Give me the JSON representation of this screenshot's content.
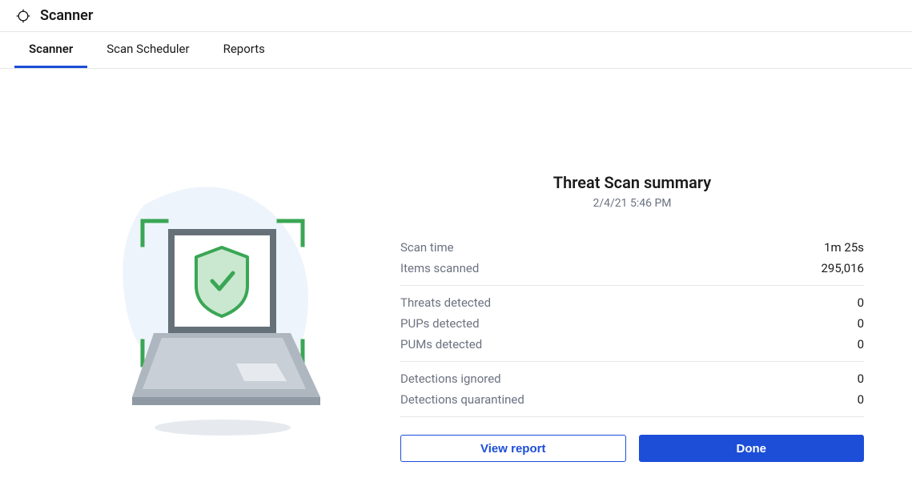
{
  "header": {
    "title": "Scanner"
  },
  "tabs": [
    {
      "label": "Scanner",
      "active": true
    },
    {
      "label": "Scan Scheduler",
      "active": false
    },
    {
      "label": "Reports",
      "active": false
    }
  ],
  "summary": {
    "title": "Threat Scan summary",
    "timestamp": "2/4/21 5:46 PM",
    "groups": [
      [
        {
          "label": "Scan time",
          "value": "1m 25s"
        },
        {
          "label": "Items scanned",
          "value": "295,016"
        }
      ],
      [
        {
          "label": "Threats detected",
          "value": "0"
        },
        {
          "label": "PUPs detected",
          "value": "0"
        },
        {
          "label": "PUMs detected",
          "value": "0"
        }
      ],
      [
        {
          "label": "Detections ignored",
          "value": "0"
        },
        {
          "label": "Detections quarantined",
          "value": "0"
        }
      ]
    ]
  },
  "buttons": {
    "view_report": "View report",
    "done": "Done"
  }
}
